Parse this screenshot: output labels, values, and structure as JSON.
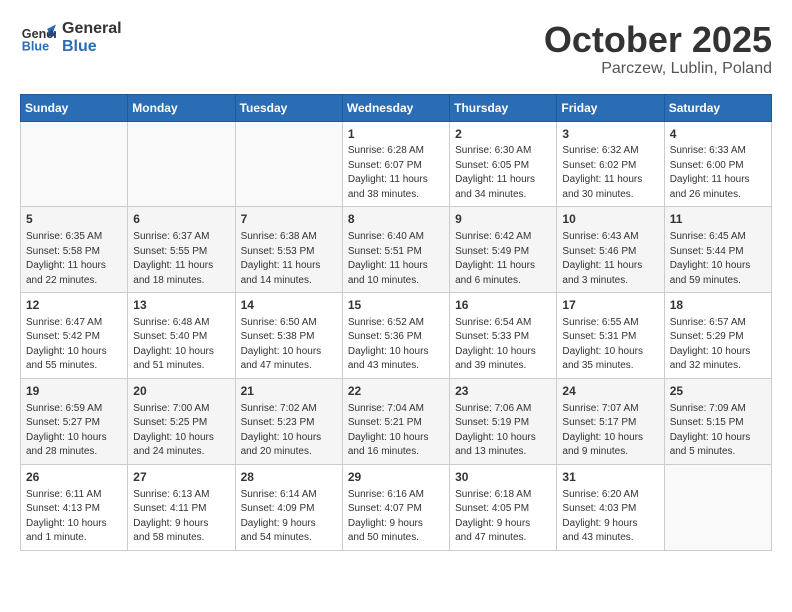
{
  "header": {
    "logo_line1": "General",
    "logo_line2": "Blue",
    "month_title": "October 2025",
    "location": "Parczew, Lublin, Poland"
  },
  "days_of_week": [
    "Sunday",
    "Monday",
    "Tuesday",
    "Wednesday",
    "Thursday",
    "Friday",
    "Saturday"
  ],
  "weeks": [
    [
      {
        "day": "",
        "info": ""
      },
      {
        "day": "",
        "info": ""
      },
      {
        "day": "",
        "info": ""
      },
      {
        "day": "1",
        "info": "Sunrise: 6:28 AM\nSunset: 6:07 PM\nDaylight: 11 hours\nand 38 minutes."
      },
      {
        "day": "2",
        "info": "Sunrise: 6:30 AM\nSunset: 6:05 PM\nDaylight: 11 hours\nand 34 minutes."
      },
      {
        "day": "3",
        "info": "Sunrise: 6:32 AM\nSunset: 6:02 PM\nDaylight: 11 hours\nand 30 minutes."
      },
      {
        "day": "4",
        "info": "Sunrise: 6:33 AM\nSunset: 6:00 PM\nDaylight: 11 hours\nand 26 minutes."
      }
    ],
    [
      {
        "day": "5",
        "info": "Sunrise: 6:35 AM\nSunset: 5:58 PM\nDaylight: 11 hours\nand 22 minutes."
      },
      {
        "day": "6",
        "info": "Sunrise: 6:37 AM\nSunset: 5:55 PM\nDaylight: 11 hours\nand 18 minutes."
      },
      {
        "day": "7",
        "info": "Sunrise: 6:38 AM\nSunset: 5:53 PM\nDaylight: 11 hours\nand 14 minutes."
      },
      {
        "day": "8",
        "info": "Sunrise: 6:40 AM\nSunset: 5:51 PM\nDaylight: 11 hours\nand 10 minutes."
      },
      {
        "day": "9",
        "info": "Sunrise: 6:42 AM\nSunset: 5:49 PM\nDaylight: 11 hours\nand 6 minutes."
      },
      {
        "day": "10",
        "info": "Sunrise: 6:43 AM\nSunset: 5:46 PM\nDaylight: 11 hours\nand 3 minutes."
      },
      {
        "day": "11",
        "info": "Sunrise: 6:45 AM\nSunset: 5:44 PM\nDaylight: 10 hours\nand 59 minutes."
      }
    ],
    [
      {
        "day": "12",
        "info": "Sunrise: 6:47 AM\nSunset: 5:42 PM\nDaylight: 10 hours\nand 55 minutes."
      },
      {
        "day": "13",
        "info": "Sunrise: 6:48 AM\nSunset: 5:40 PM\nDaylight: 10 hours\nand 51 minutes."
      },
      {
        "day": "14",
        "info": "Sunrise: 6:50 AM\nSunset: 5:38 PM\nDaylight: 10 hours\nand 47 minutes."
      },
      {
        "day": "15",
        "info": "Sunrise: 6:52 AM\nSunset: 5:36 PM\nDaylight: 10 hours\nand 43 minutes."
      },
      {
        "day": "16",
        "info": "Sunrise: 6:54 AM\nSunset: 5:33 PM\nDaylight: 10 hours\nand 39 minutes."
      },
      {
        "day": "17",
        "info": "Sunrise: 6:55 AM\nSunset: 5:31 PM\nDaylight: 10 hours\nand 35 minutes."
      },
      {
        "day": "18",
        "info": "Sunrise: 6:57 AM\nSunset: 5:29 PM\nDaylight: 10 hours\nand 32 minutes."
      }
    ],
    [
      {
        "day": "19",
        "info": "Sunrise: 6:59 AM\nSunset: 5:27 PM\nDaylight: 10 hours\nand 28 minutes."
      },
      {
        "day": "20",
        "info": "Sunrise: 7:00 AM\nSunset: 5:25 PM\nDaylight: 10 hours\nand 24 minutes."
      },
      {
        "day": "21",
        "info": "Sunrise: 7:02 AM\nSunset: 5:23 PM\nDaylight: 10 hours\nand 20 minutes."
      },
      {
        "day": "22",
        "info": "Sunrise: 7:04 AM\nSunset: 5:21 PM\nDaylight: 10 hours\nand 16 minutes."
      },
      {
        "day": "23",
        "info": "Sunrise: 7:06 AM\nSunset: 5:19 PM\nDaylight: 10 hours\nand 13 minutes."
      },
      {
        "day": "24",
        "info": "Sunrise: 7:07 AM\nSunset: 5:17 PM\nDaylight: 10 hours\nand 9 minutes."
      },
      {
        "day": "25",
        "info": "Sunrise: 7:09 AM\nSunset: 5:15 PM\nDaylight: 10 hours\nand 5 minutes."
      }
    ],
    [
      {
        "day": "26",
        "info": "Sunrise: 6:11 AM\nSunset: 4:13 PM\nDaylight: 10 hours\nand 1 minute."
      },
      {
        "day": "27",
        "info": "Sunrise: 6:13 AM\nSunset: 4:11 PM\nDaylight: 9 hours\nand 58 minutes."
      },
      {
        "day": "28",
        "info": "Sunrise: 6:14 AM\nSunset: 4:09 PM\nDaylight: 9 hours\nand 54 minutes."
      },
      {
        "day": "29",
        "info": "Sunrise: 6:16 AM\nSunset: 4:07 PM\nDaylight: 9 hours\nand 50 minutes."
      },
      {
        "day": "30",
        "info": "Sunrise: 6:18 AM\nSunset: 4:05 PM\nDaylight: 9 hours\nand 47 minutes."
      },
      {
        "day": "31",
        "info": "Sunrise: 6:20 AM\nSunset: 4:03 PM\nDaylight: 9 hours\nand 43 minutes."
      },
      {
        "day": "",
        "info": ""
      }
    ]
  ]
}
